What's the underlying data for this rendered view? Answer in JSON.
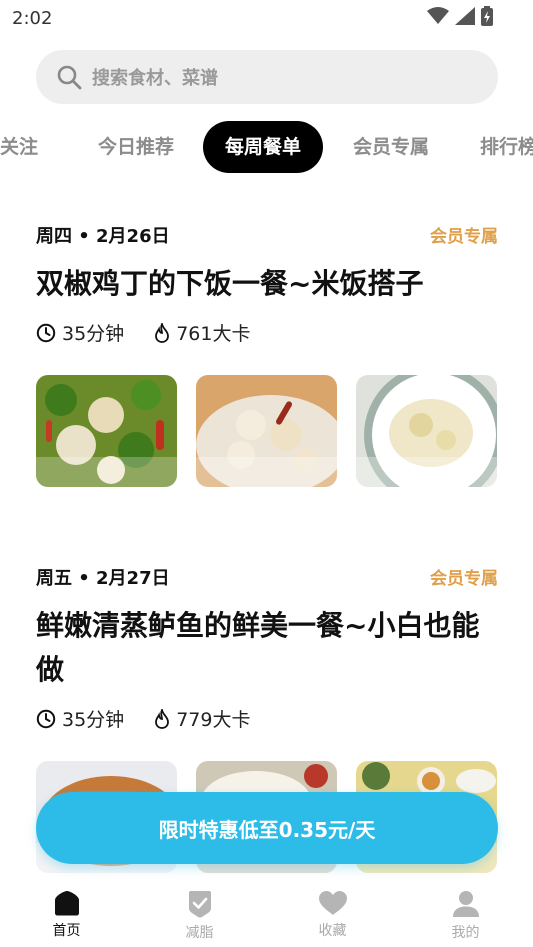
{
  "status_bar": {
    "time": "2:02"
  },
  "search": {
    "placeholder": "搜索食材、菜谱",
    "icon": "search-icon"
  },
  "tabs": [
    {
      "label": "关注"
    },
    {
      "label": "今日推荐"
    },
    {
      "label": "每周餐单",
      "active": true
    },
    {
      "label": "会员专属"
    },
    {
      "label": "排行榜"
    }
  ],
  "cards": [
    {
      "date": "周四 • 2月26日",
      "badge": "会员专属",
      "title": "双椒鸡丁的下饭一餐~米饭搭子",
      "time": "35分钟",
      "calories": "761大卡"
    },
    {
      "date": "周五 • 2月27日",
      "badge": "会员专属",
      "title": "鲜嫩清蒸鲈鱼的鲜美一餐~小白也能做",
      "time": "35分钟",
      "calories": "779大卡"
    }
  ],
  "cta": {
    "label": "限时特惠低至0.35元/天",
    "color": "#2dbbe8"
  },
  "bottom_nav": [
    {
      "label": "首页",
      "icon": "home-icon",
      "active": true
    },
    {
      "label": "减脂",
      "icon": "shield-check-icon"
    },
    {
      "label": "收藏",
      "icon": "heart-icon"
    },
    {
      "label": "我的",
      "icon": "user-icon"
    }
  ],
  "colors": {
    "accent_badge": "#e0a04a",
    "tab_active_bg": "#000000"
  }
}
